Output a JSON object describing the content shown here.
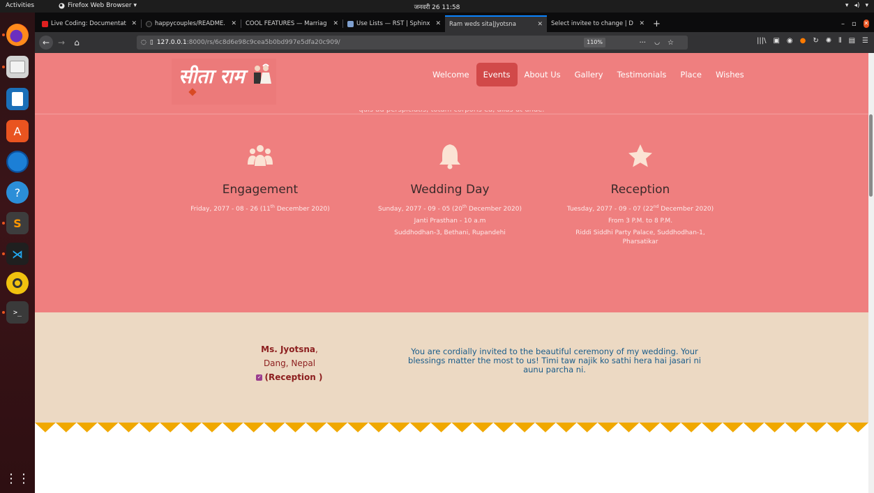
{
  "topbar": {
    "activities": "Activities",
    "app_name": "Firefox Web Browser ▾",
    "clock": "जनवरी 26  11:58"
  },
  "tabs": [
    {
      "label": "Live Coding: Documentat",
      "icon_color": "#e02020"
    },
    {
      "label": "happycouples/README.",
      "icon_color": "#1b1b1b"
    },
    {
      "label": "COOL FEATURES — Marriag",
      "icon_color": "#2a2a2a"
    },
    {
      "label": "Use Lists — RST | Sphinx",
      "icon_color": "#7fa0d0"
    },
    {
      "label": "Ram weds sita|Jyotsna",
      "icon_color": "#323234"
    },
    {
      "label": "Select invitee to change | D",
      "icon_color": "#0c4b33"
    }
  ],
  "urlbar": {
    "host": "127.0.0.1",
    "path": ":8000/rs/6c8d6e98c9cea5b0bd997e5dfa20c909/",
    "zoom": "110%"
  },
  "site": {
    "logo_text": "सीता राम",
    "nav": [
      "Welcome",
      "Events",
      "About Us",
      "Gallery",
      "Testimonials",
      "Place",
      "Wishes"
    ],
    "active_nav": "Events",
    "cut_text": "quis ad perspiciatis, totam corporis ea, alias ut unde."
  },
  "events": [
    {
      "icon": "users-icon",
      "title": "Engagement",
      "date_prefix": "Friday, 2077 - 08 - 26 (11",
      "date_sup": "th",
      "date_suffix": " December 2020)",
      "lines": []
    },
    {
      "icon": "bell-icon",
      "title": "Wedding Day",
      "date_prefix": "Sunday, 2077 - 09 - 05 (20",
      "date_sup": "th",
      "date_suffix": " December 2020)",
      "lines": [
        "Janti Prasthan - 10 a.m",
        "Suddhodhan-3, Bethani, Rupandehi"
      ]
    },
    {
      "icon": "star-icon",
      "title": "Reception",
      "date_prefix": "Tuesday, 2077 - 09 - 07 (22",
      "date_sup": "nd",
      "date_suffix": " December 2020)",
      "lines": [
        "From 3 P.M. to 8 P.M.",
        "Riddi Siddhi Party Palace, Suddhodhan-1,",
        "Pharsatikar"
      ]
    }
  ],
  "invite": {
    "name": "Ms. Jyotsna",
    "comma": ",",
    "place": "Dang, Nepal",
    "invite_type": "(Reception )",
    "message": "You are cordially invited to the beautiful ceremony of my wedding. Your blessings matter the most to us! Timi taw najik ko sathi hera hai jasari ni aunu parcha ni."
  },
  "colors": {
    "pink": "#ef7f7f",
    "beige": "#ecd9c3",
    "triangle": "#f0a800",
    "nav_active": "#d14949"
  }
}
